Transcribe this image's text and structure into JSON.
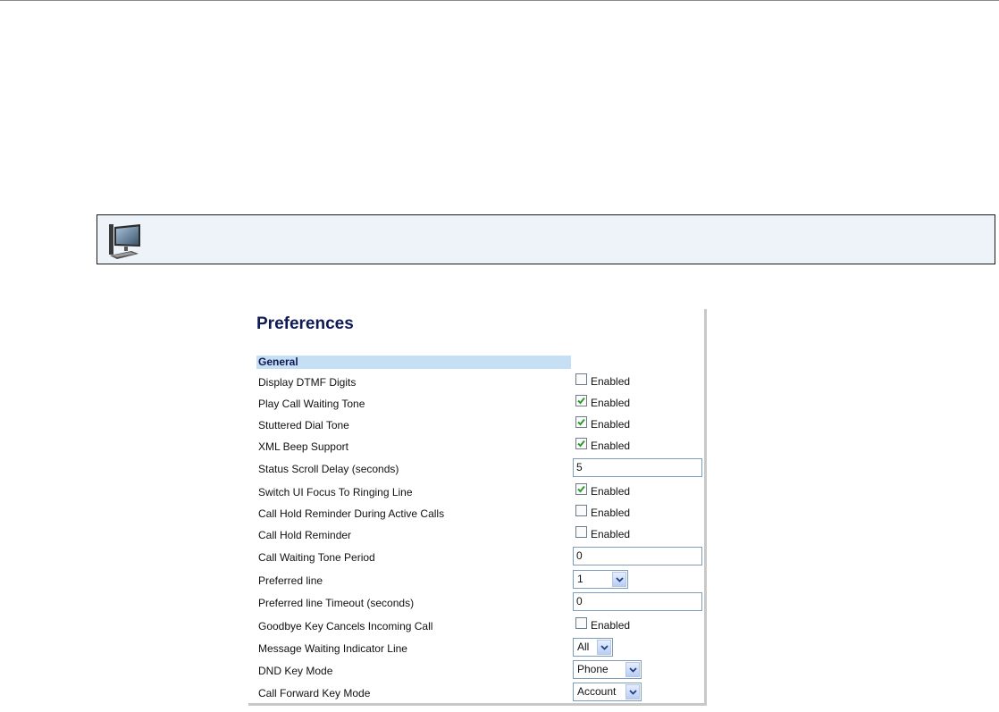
{
  "panel": {
    "title": "Preferences",
    "section": "General",
    "rows": [
      {
        "label": "Display DTMF Digits",
        "type": "checkbox",
        "checked": false,
        "text": "Enabled"
      },
      {
        "label": "Play Call Waiting Tone",
        "type": "checkbox",
        "checked": true,
        "text": "Enabled"
      },
      {
        "label": "Stuttered Dial Tone",
        "type": "checkbox",
        "checked": true,
        "text": "Enabled"
      },
      {
        "label": "XML Beep Support",
        "type": "checkbox",
        "checked": true,
        "text": "Enabled"
      },
      {
        "label": "Status Scroll Delay (seconds)",
        "type": "text",
        "value": "5"
      },
      {
        "label": "Switch UI Focus To Ringing Line",
        "type": "checkbox",
        "checked": true,
        "text": "Enabled"
      },
      {
        "label": "Call Hold Reminder During Active Calls",
        "type": "checkbox",
        "checked": false,
        "text": "Enabled"
      },
      {
        "label": "Call Hold Reminder",
        "type": "checkbox",
        "checked": false,
        "text": "Enabled"
      },
      {
        "label": "Call Waiting Tone Period",
        "type": "text",
        "value": "0"
      },
      {
        "label": "Preferred line",
        "type": "select",
        "value": "1"
      },
      {
        "label": "Preferred line Timeout (seconds)",
        "type": "text",
        "value": "0"
      },
      {
        "label": "Goodbye Key Cancels Incoming Call",
        "type": "checkbox",
        "checked": false,
        "text": "Enabled"
      },
      {
        "label": "Message Waiting Indicator Line",
        "type": "select",
        "value": "All"
      },
      {
        "label": "DND Key Mode",
        "type": "select",
        "value": "Phone"
      },
      {
        "label": "Call Forward Key Mode",
        "type": "select",
        "value": "Account"
      }
    ]
  },
  "colors": {
    "title": "#0f1a55",
    "section_bg": "#c5dff4",
    "note_bg": "#eef3f9",
    "check": "#2f9a2f"
  },
  "icons": {
    "note": "computer-monitor-icon"
  }
}
